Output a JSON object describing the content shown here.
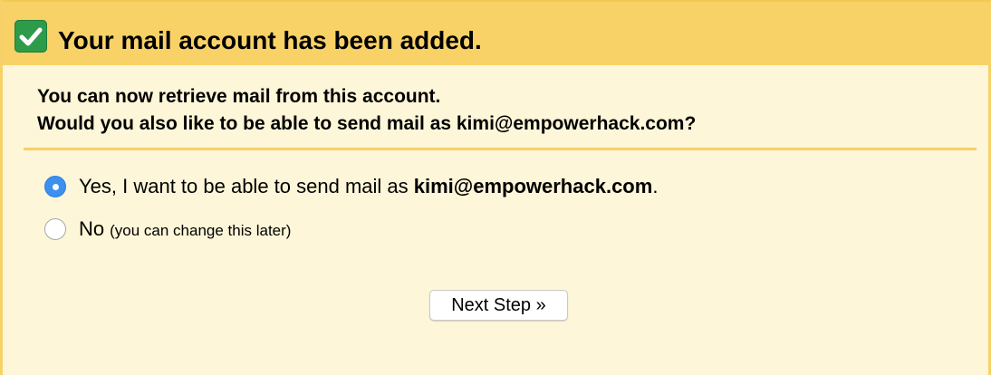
{
  "header": {
    "icon": "check-icon",
    "title": "Your mail account has been added."
  },
  "intro": {
    "line1": "You can now retrieve mail from this account.",
    "line2": "Would you also like to be able to send mail as kimi@empowerhack.com?"
  },
  "options": {
    "yes": {
      "selected": true,
      "prefix": "Yes, I want to be able to send mail as ",
      "email": "kimi@empowerhack.com",
      "suffix": "."
    },
    "no": {
      "selected": false,
      "label": "No",
      "note": "(you can change this later)"
    }
  },
  "buttons": {
    "next": "Next Step »"
  },
  "colors": {
    "header_bg": "#f9d267",
    "body_bg": "#fdf6d8",
    "check_green": "#2e9b4a",
    "radio_blue": "#3d8ff0"
  }
}
